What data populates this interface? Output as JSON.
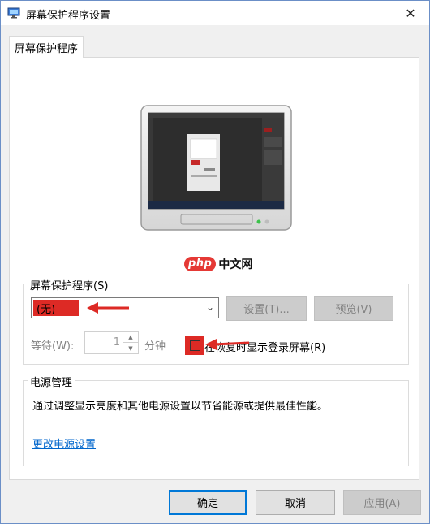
{
  "window": {
    "title": "屏幕保护程序设置",
    "close_glyph": "✕"
  },
  "tabs": [
    {
      "label": "屏幕保护程序"
    }
  ],
  "watermark": {
    "badge": "php",
    "text": "中文网"
  },
  "screensaver_group": {
    "legend": "屏幕保护程序(S)",
    "select_value": "(无)",
    "settings_button": "设置(T)...",
    "preview_button": "预览(V)",
    "wait_label": "等待(W):",
    "wait_value": "1",
    "wait_unit": "分钟",
    "resume_checkbox_label": "在恢复时显示登录屏幕(R)",
    "resume_checked": false
  },
  "power_group": {
    "legend": "电源管理",
    "description": "通过调整显示亮度和其他电源设置以节省能源或提供最佳性能。",
    "link": "更改电源设置"
  },
  "footer": {
    "ok": "确定",
    "cancel": "取消",
    "apply": "应用(A)"
  },
  "annotation_color": "#dd2a25",
  "accent_color": "#0078d7"
}
